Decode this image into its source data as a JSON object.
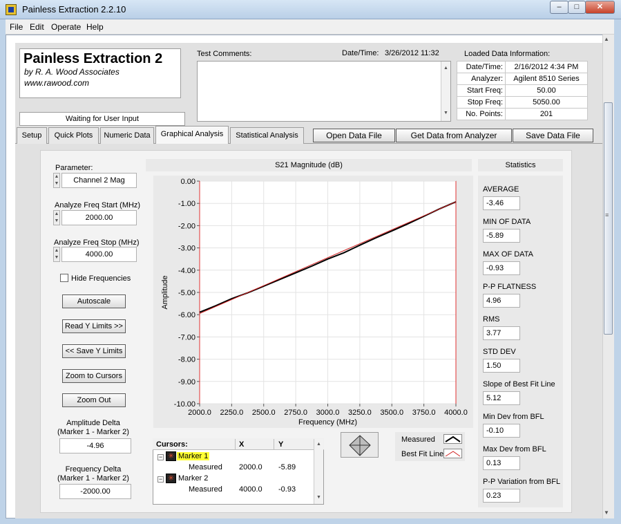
{
  "window": {
    "title": "Painless Extraction 2.2.10",
    "min": "–",
    "max": "□",
    "close": "✕"
  },
  "menu": [
    "File",
    "Edit",
    "Operate",
    "Help"
  ],
  "brand": {
    "title": "Painless Extraction 2",
    "by": "by R. A. Wood Associates",
    "url": "www.rawood.com"
  },
  "status": "Waiting for User Input",
  "test_comments_label": "Test Comments:",
  "datetime": {
    "label": "Date/Time:",
    "value": "3/26/2012  11:32"
  },
  "loaded": {
    "label": "Loaded Data Information:",
    "rows": [
      {
        "k": "Date/Time:",
        "v": "2/16/2012 4:34 PM"
      },
      {
        "k": "Analyzer:",
        "v": "Agilent 8510 Series"
      },
      {
        "k": "Start Freq:",
        "v": "50.00"
      },
      {
        "k": "Stop Freq:",
        "v": "5050.00"
      },
      {
        "k": "No. Points:",
        "v": "201"
      }
    ]
  },
  "tabs": [
    "Setup",
    "Quick Plots",
    "Numeric Data",
    "Graphical Analysis",
    "Statistical Analysis"
  ],
  "top_buttons": [
    "Open Data File",
    "Get Data from Analyzer",
    "Save Data File"
  ],
  "left": {
    "param_label": "Parameter:",
    "param_value": "Channel 2 Mag",
    "start_label": "Analyze Freq Start (MHz)",
    "start_value": "2000.00",
    "stop_label": "Analyze Freq Stop (MHz)",
    "stop_value": "4000.00",
    "hide_label": "Hide Frequencies",
    "buttons": [
      "Autoscale",
      "Read Y Limits >>",
      "<< Save Y Limits",
      "Zoom to Cursors",
      "Zoom Out"
    ],
    "amp_delta_label1": "Amplitude Delta",
    "amp_delta_label2": "(Marker 1 - Marker 2)",
    "amp_delta_value": "-4.96",
    "freq_delta_label1": "Frequency Delta",
    "freq_delta_label2": "(Marker 1 - Marker 2)",
    "freq_delta_value": "-2000.00"
  },
  "chart_data": {
    "type": "line",
    "title": "S21 Magnitude (dB)",
    "xlabel": "Frequency (MHz)",
    "ylabel": "Amplitude",
    "xlim": [
      2000,
      4000
    ],
    "ylim": [
      -10,
      0
    ],
    "xticks": [
      "2000.0",
      "2250.0",
      "2500.0",
      "2750.0",
      "3000.0",
      "3250.0",
      "3500.0",
      "3750.0",
      "4000.0"
    ],
    "yticks": [
      "0.00",
      "-1.00",
      "-2.00",
      "-3.00",
      "-4.00",
      "-5.00",
      "-6.00",
      "-7.00",
      "-8.00",
      "-9.00",
      "-10.00"
    ],
    "grid": true,
    "series": [
      {
        "name": "Measured",
        "color": "#000000",
        "x": [
          2000,
          2125,
          2250,
          2375,
          2500,
          2625,
          2750,
          2875,
          3000,
          3125,
          3250,
          3375,
          3500,
          3625,
          3750,
          3875,
          4000
        ],
        "y": [
          -5.89,
          -5.6,
          -5.28,
          -5.02,
          -4.72,
          -4.42,
          -4.12,
          -3.82,
          -3.5,
          -3.22,
          -2.88,
          -2.55,
          -2.24,
          -1.92,
          -1.58,
          -1.24,
          -0.93
        ]
      },
      {
        "name": "Best Fit Line",
        "color": "#d02020",
        "x": [
          2000,
          4000
        ],
        "y": [
          -5.95,
          -0.93
        ]
      }
    ],
    "legend": "bottom-right"
  },
  "stats": {
    "title": "Statistics",
    "items": [
      {
        "k": "AVERAGE",
        "v": "-3.46"
      },
      {
        "k": "MIN OF DATA",
        "v": "-5.89"
      },
      {
        "k": "MAX OF DATA",
        "v": "-0.93"
      },
      {
        "k": "P-P FLATNESS",
        "v": "4.96"
      },
      {
        "k": "RMS",
        "v": "3.77"
      },
      {
        "k": "STD DEV",
        "v": "1.50"
      },
      {
        "k": "Slope of Best Fit Line",
        "v": "5.12"
      },
      {
        "k": "Min Dev from BFL",
        "v": "-0.10"
      },
      {
        "k": "Max Dev from BFL",
        "v": "0.13"
      },
      {
        "k": "P-P Variation from BFL",
        "v": "0.23"
      }
    ]
  },
  "cursors": {
    "headers": [
      "Cursors:",
      "X",
      "Y"
    ],
    "rows": [
      {
        "marker": "Marker 1",
        "trace": "Measured",
        "x": "2000.0",
        "y": "-5.89"
      },
      {
        "marker": "Marker 2",
        "trace": "Measured",
        "x": "4000.0",
        "y": "-0.93"
      }
    ]
  },
  "legend": {
    "measured": "Measured",
    "bfl": "Best Fit Line"
  }
}
